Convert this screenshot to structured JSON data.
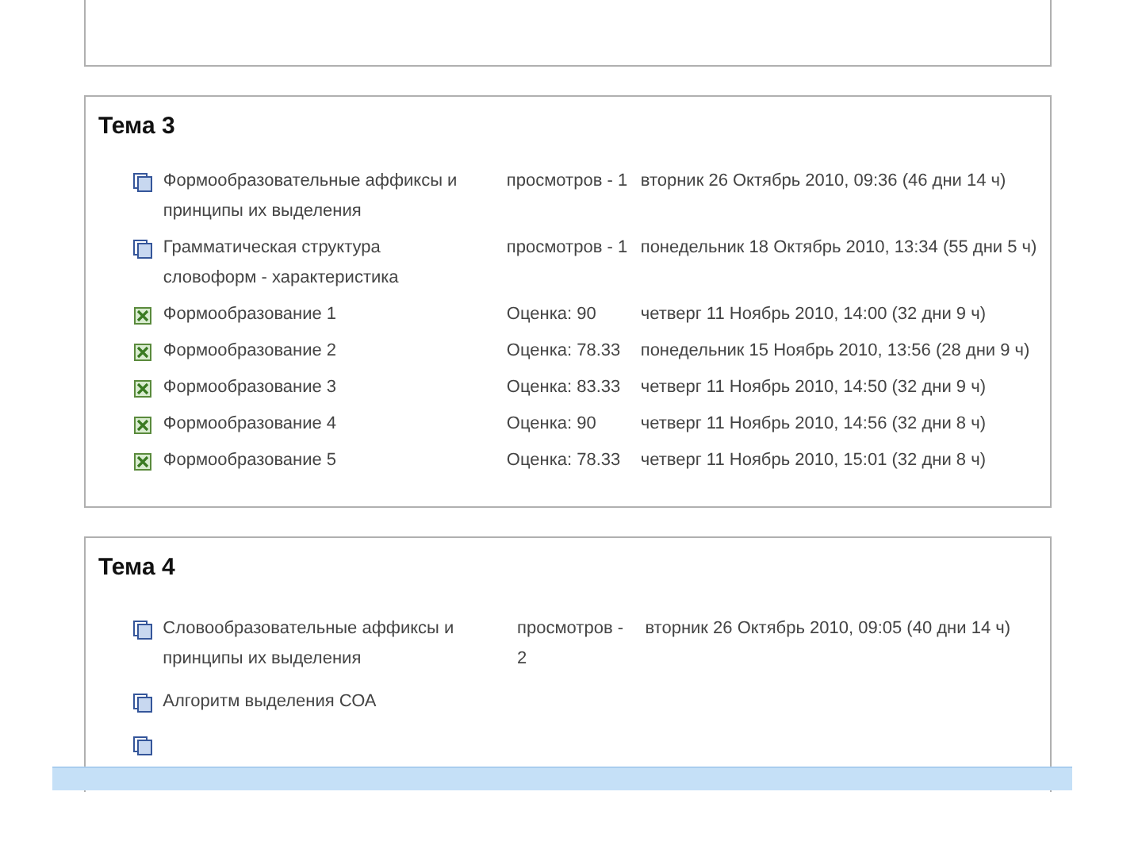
{
  "sections": [
    {
      "title": "Тема 3",
      "rows": [
        {
          "kind": "resource",
          "name": "Формообразовательные аффиксы и принципы их выделения",
          "info": "просмотров - 1",
          "date": "вторник 26 Октябрь 2010, 09:36 (46 дни 14 ч)"
        },
        {
          "kind": "resource",
          "name": "Грамматическая структура словоформ - характеристика",
          "info": "просмотров - 1",
          "date": "понедельник 18 Октябрь 2010, 13:34 (55 дни 5 ч)"
        },
        {
          "kind": "quiz",
          "name": "Формообразование 1",
          "info": "Оценка: 90",
          "date": "четверг 11 Ноябрь 2010, 14:00 (32 дни 9 ч)"
        },
        {
          "kind": "quiz",
          "name": "Формообразование 2",
          "info": "Оценка: 78.33",
          "date": "понедельник 15 Ноябрь 2010, 13:56 (28 дни 9 ч)"
        },
        {
          "kind": "quiz",
          "name": "Формообразование 3",
          "info": "Оценка: 83.33",
          "date": "четверг 11 Ноябрь 2010, 14:50 (32 дни 9 ч)"
        },
        {
          "kind": "quiz",
          "name": "Формообразование 4",
          "info": "Оценка: 90",
          "date": "четверг 11 Ноябрь 2010, 14:56 (32 дни 8 ч)"
        },
        {
          "kind": "quiz",
          "name": "Формообразование 5",
          "info": "Оценка: 78.33",
          "date": "четверг 11 Ноябрь 2010, 15:01 (32 дни 8 ч)"
        }
      ]
    },
    {
      "title": "Тема 4",
      "rows": [
        {
          "kind": "resource",
          "name": "Словообразовательные аффиксы и принципы их выделения",
          "info": "просмотров - 2",
          "date": "вторник 26 Октябрь 2010, 09:05 (40 дни 14 ч)"
        },
        {
          "kind": "resource",
          "name": "Алгоритм выделения СОА"
        },
        {
          "kind": "resource"
        }
      ]
    }
  ]
}
